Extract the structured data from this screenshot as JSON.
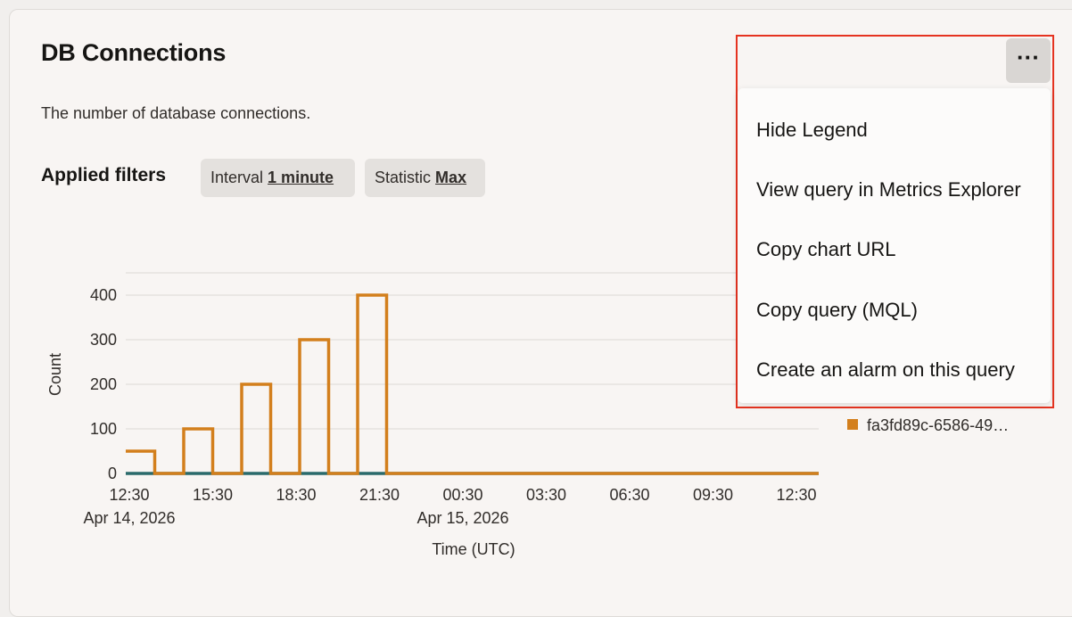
{
  "widget": {
    "title": "DB Connections",
    "description": "The number of database connections.",
    "filters_label": "Applied filters",
    "filters": [
      {
        "label": "Interval",
        "value": "1 minute"
      },
      {
        "label": "Statistic",
        "value": "Max"
      }
    ]
  },
  "menu": {
    "button_label": "···",
    "items": [
      "Hide Legend",
      "View query in Metrics Explorer",
      "Copy chart URL",
      "Copy query (MQL)",
      "Create an alarm on this query"
    ]
  },
  "legend": {
    "entries": [
      {
        "name": "fa3fd89c-6586-49…",
        "color": "#d37f1c"
      }
    ]
  },
  "chart_data": {
    "type": "line",
    "ylabel": "Count",
    "xlabel": "Time (UTC)",
    "ylim": [
      0,
      400
    ],
    "yticks": [
      0,
      100,
      200,
      300,
      400
    ],
    "xticks": [
      "12:30",
      "15:30",
      "18:30",
      "21:30",
      "00:30",
      "03:30",
      "06:30",
      "09:30",
      "12:30"
    ],
    "xtick_dates": [
      {
        "tick": "12:30",
        "label": "Apr 14, 2026"
      },
      {
        "tick": "00:30",
        "label": "Apr 15, 2026"
      }
    ],
    "grid": true,
    "series": [
      {
        "color": "#d37f1c",
        "step_values": [
          50,
          0,
          100,
          0,
          200,
          0,
          300,
          0,
          400,
          0,
          0
        ]
      },
      {
        "color": "#2a6a6b",
        "step_values": [
          0,
          0,
          0,
          0,
          0,
          0,
          0,
          0,
          0,
          0,
          0
        ]
      }
    ]
  }
}
